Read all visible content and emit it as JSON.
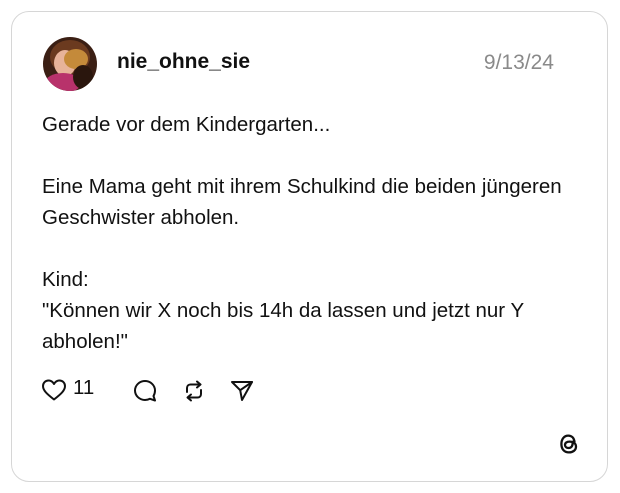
{
  "post": {
    "username": "nie_ohne_sie",
    "date": "9/13/24",
    "paragraphs": [
      "Gerade vor dem Kindergarten...",
      "Eine Mama geht mit ihrem Schulkind die beiden jüngeren Geschwister abholen.",
      "Kind:\n\"Können wir X noch bis 14h da lassen und jetzt nur Y abholen!\""
    ],
    "like_count": "11"
  },
  "icons": {
    "like": "heart-icon",
    "reply": "speech-bubble-icon",
    "repost": "repost-arrows-icon",
    "share": "paper-plane-icon",
    "brand": "threads-logo-icon"
  },
  "colors": {
    "text": "#111111",
    "date": "#8a8a8a",
    "border": "#d6d6d6"
  }
}
